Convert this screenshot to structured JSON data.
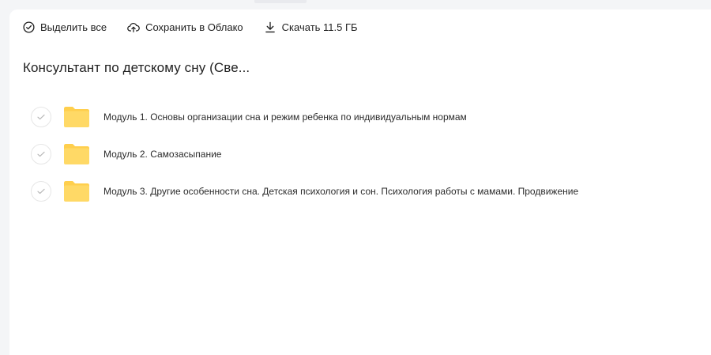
{
  "toolbar": {
    "select_all_label": "Выделить все",
    "save_to_cloud_label": "Сохранить в Облако",
    "download_label": "Скачать 11.5 ГБ"
  },
  "folder": {
    "title": "Консультант по детскому сну (Све..."
  },
  "items": [
    {
      "name": "Модуль 1. Основы организации сна и режим ребенка по индивидуальным нормам"
    },
    {
      "name": "Модуль 2. Самозасыпание"
    },
    {
      "name": "Модуль 3. Другие особенности сна. Детская психология и сон. Психология работы с мамами. Продвижение"
    }
  ],
  "colors": {
    "folder_yellow": "#ffd966",
    "folder_yellow_back": "#ffcf4d",
    "check_gray": "#b8b8b8",
    "icon_dark": "#1f1f1f"
  },
  "icons": {
    "select_all": "check-circle-icon",
    "save_to_cloud": "cloud-upload-icon",
    "download": "download-icon",
    "item": "folder-icon",
    "item_check": "checkmark-icon"
  }
}
